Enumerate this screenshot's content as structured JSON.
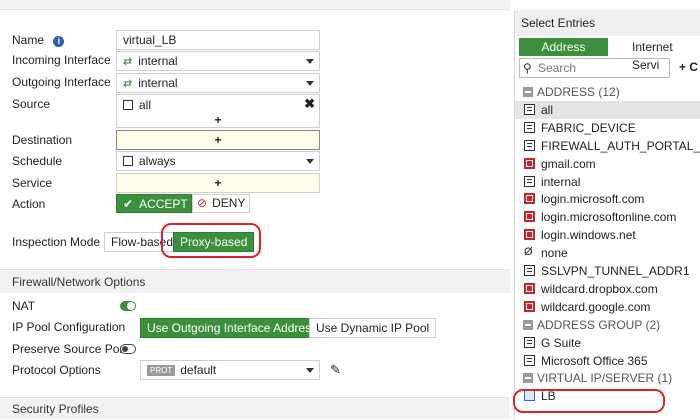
{
  "form": {
    "name_label": "Name",
    "name_value": "virtual_LB",
    "incoming_label": "Incoming Interface",
    "incoming_value": "internal",
    "outgoing_label": "Outgoing Interface",
    "outgoing_value": "internal",
    "source_label": "Source",
    "source_value": "all",
    "destination_label": "Destination",
    "schedule_label": "Schedule",
    "schedule_value": "always",
    "service_label": "Service",
    "action_label": "Action",
    "accept_label": "ACCEPT",
    "deny_label": "DENY",
    "inspection_label": "Inspection Mode",
    "flow_label": "Flow-based",
    "proxy_label": "Proxy-based",
    "plus_glyph": "+"
  },
  "firewall": {
    "section_title": "Firewall/Network Options",
    "nat_label": "NAT",
    "ippool_label": "IP Pool Configuration",
    "use_outgoing_label": "Use Outgoing Interface Address",
    "use_dynamic_label": "Use Dynamic IP Pool",
    "preserve_label": "Preserve Source Port",
    "protocol_label": "Protocol Options",
    "prot_badge": "PROT",
    "protocol_value": "default"
  },
  "security": {
    "section_title": "Security Profiles"
  },
  "panel": {
    "title": "Select Entries",
    "tab_address": "Address",
    "tab_services": "Internet Servi",
    "search_placeholder": "Search",
    "create_glyph": "+ C",
    "groups": [
      {
        "label": "ADDRESS (12)"
      },
      {
        "label": "ADDRESS GROUP (2)"
      },
      {
        "label": "VIRTUAL IP/SERVER (1)"
      }
    ],
    "addresses": [
      "all",
      "FABRIC_DEVICE",
      "FIREWALL_AUTH_PORTAL_ADDRESS",
      "gmail.com",
      "internal",
      "login.microsoft.com",
      "login.microsoftonline.com",
      "login.windows.net",
      "none",
      "SSLVPN_TUNNEL_ADDR1",
      "wildcard.dropbox.com",
      "wildcard.google.com"
    ],
    "address_groups": [
      "G Suite",
      "Microsoft Office 365"
    ],
    "virtual_ips": [
      "LB"
    ]
  },
  "colors": {
    "accent": "#3c8f3c",
    "highlight": "#d9232d",
    "fqdn": "#c8242c"
  }
}
